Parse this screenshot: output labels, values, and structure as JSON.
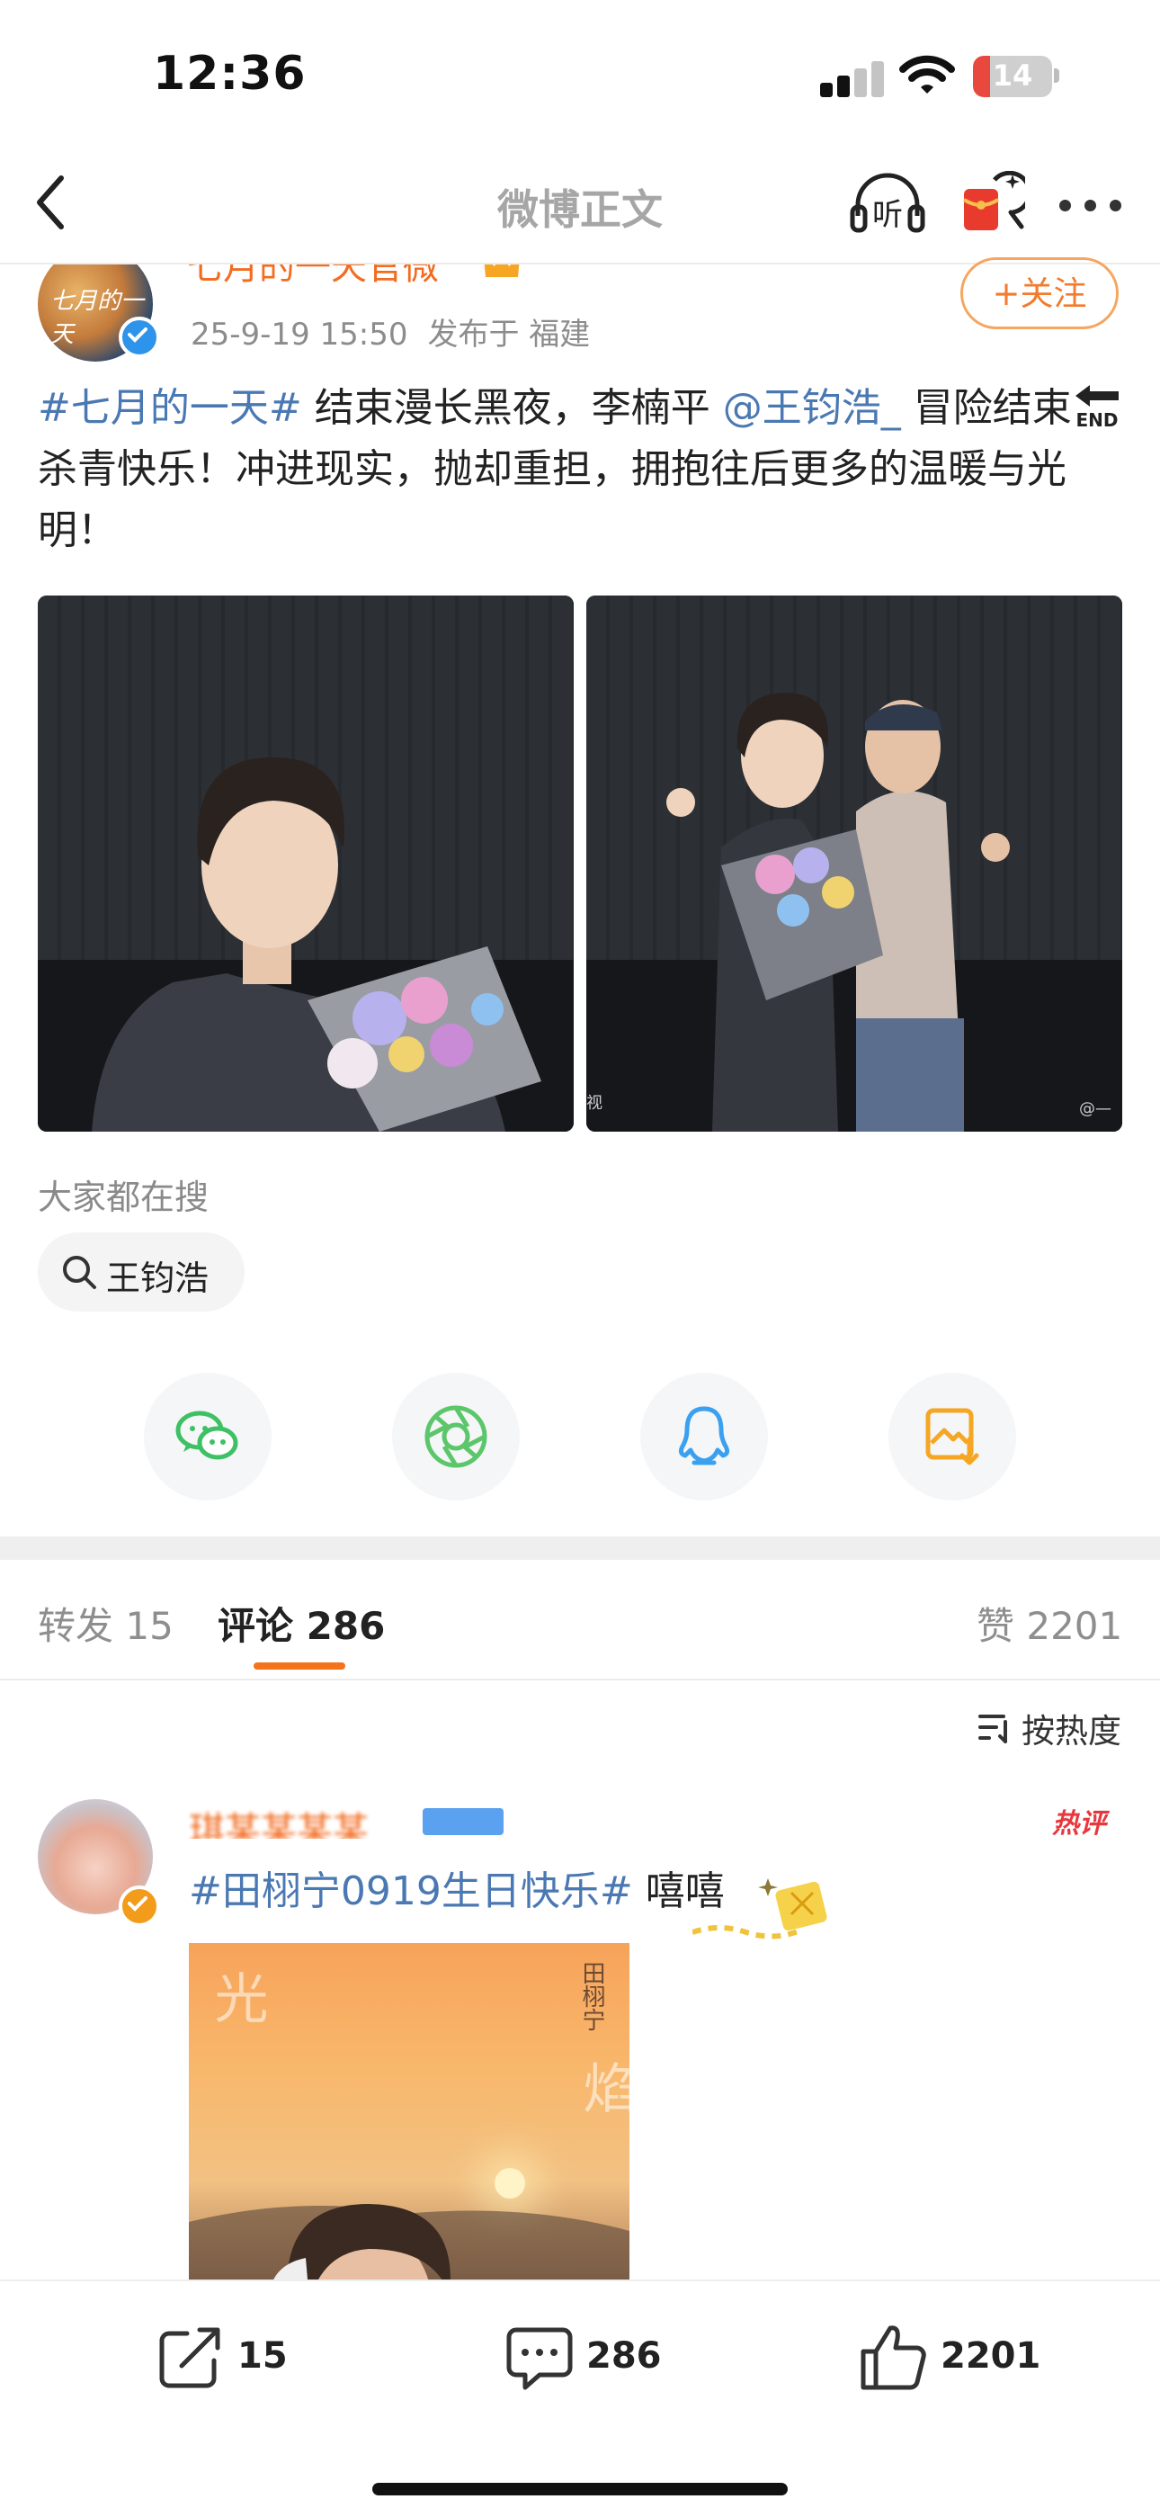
{
  "status_bar": {
    "time": "12:36",
    "battery": "14",
    "battery_color": "#e9483f"
  },
  "nav": {
    "title": "微博正文",
    "listen_label": "听"
  },
  "post": {
    "username": "七月的一天官微",
    "date": "25-9-19 15:50",
    "location": "发布于 福建",
    "follow_label": "+关注",
    "avatar_text": "七月的一天",
    "text_parts": {
      "hashtag": "#七月的一天#",
      "part1": " 结束漫长黑夜，李楠平 ",
      "mention": "@王钧浩_",
      "part2": " 冒险结束",
      "end_label": "END",
      "part3": "杀青快乐！冲进现实，抛却重担，拥抱往后更多的温暖与光明！"
    },
    "image_count": 2,
    "watermark_left": "视",
    "watermark_right": "@—"
  },
  "search": {
    "title": "大家都在搜",
    "chip": "王钧浩"
  },
  "share": {
    "icons": [
      "wechat-icon",
      "moments-icon",
      "qq-icon",
      "save-image-icon"
    ],
    "colors": {
      "wechat": "#3ec065",
      "moments": "#5cc66a",
      "qq": "#3aa0f0",
      "save": "#f5a623"
    }
  },
  "tabs": {
    "repost": "转发 15",
    "comment": "评论 286",
    "like": "赞 2201",
    "sort": "按热度",
    "accent": "#f4731c"
  },
  "comment": {
    "username": "琪某某某某",
    "hot": "热评",
    "text": "#田栩宁0919生日快乐# 嘻嘻",
    "hashtag": "#田栩宁0919生日快乐#",
    "suffix": " 嘻嘻",
    "image_text_left": "光",
    "image_text_right": "焰",
    "image_name": "田栩宁"
  },
  "bottom": {
    "repost": "15",
    "comment": "286",
    "like": "2201"
  }
}
